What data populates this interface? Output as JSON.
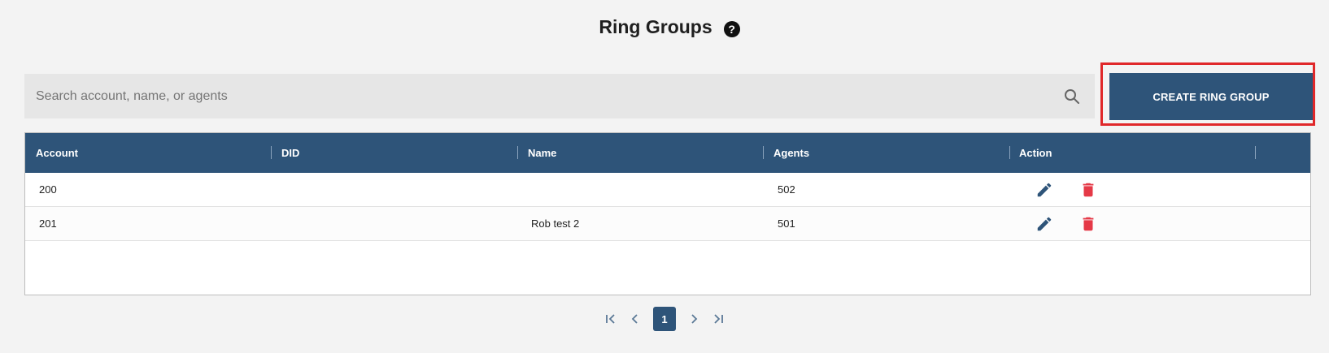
{
  "header": {
    "title": "Ring Groups",
    "help_glyph": "?"
  },
  "search": {
    "placeholder": "Search account, name, or agents",
    "value": "",
    "icon": "search-icon"
  },
  "toolbar": {
    "create_label": "CREATE RING GROUP",
    "highlight_color": "#e0282a"
  },
  "table": {
    "columns": [
      "Account",
      "DID",
      "Name",
      "Agents",
      "Action"
    ],
    "rows": [
      {
        "account": "200",
        "did": "",
        "name": "",
        "agents": "502"
      },
      {
        "account": "201",
        "did": "",
        "name": "Rob test 2",
        "agents": "501"
      }
    ],
    "action_icons": [
      "edit-icon",
      "delete-icon"
    ]
  },
  "pagination": {
    "current_page": "1",
    "controls": [
      "first-page-icon",
      "prev-page-icon",
      "next-page-icon",
      "last-page-icon"
    ]
  },
  "colors": {
    "primary": "#2e5479",
    "delete": "#e53947",
    "background": "#f3f3f3"
  }
}
